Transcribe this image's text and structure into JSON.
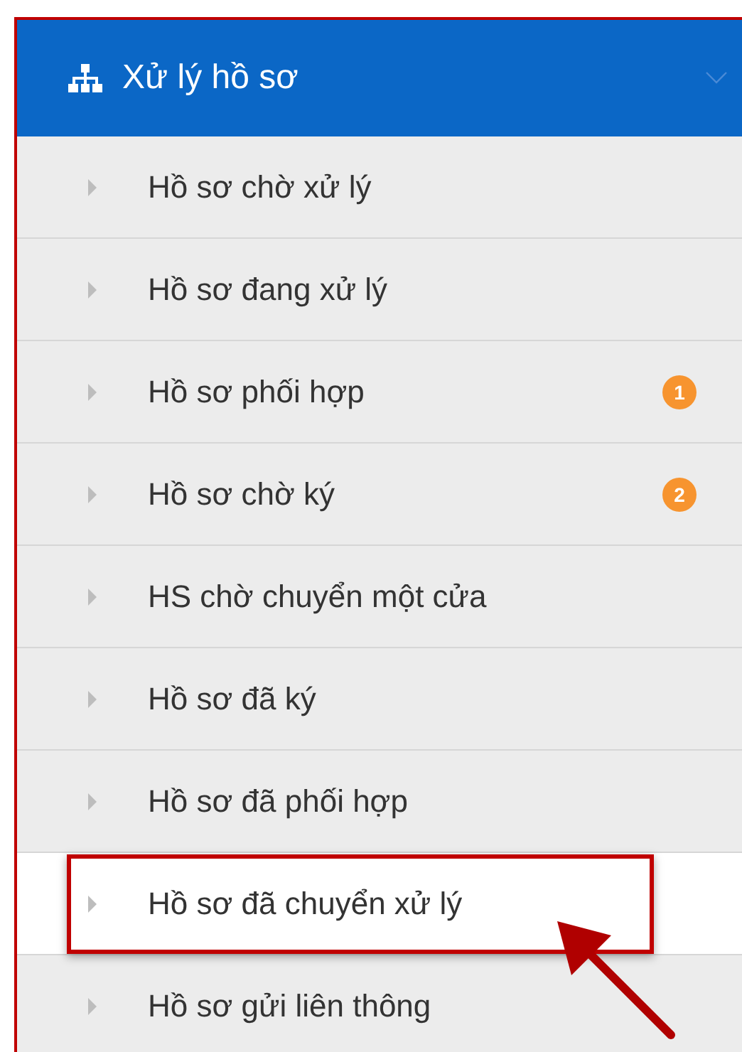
{
  "menu": {
    "title": "Xử lý hồ sơ",
    "items": [
      {
        "label": "Hồ sơ chờ xử lý",
        "selected": false
      },
      {
        "label": "Hồ sơ đang xử lý",
        "selected": false
      },
      {
        "label": "Hồ sơ phối hợp",
        "badge": "1",
        "selected": false
      },
      {
        "label": "Hồ sơ chờ ký",
        "badge": "2",
        "selected": false
      },
      {
        "label": "HS chờ chuyển một cửa",
        "selected": false
      },
      {
        "label": "Hồ sơ đã ký",
        "selected": false
      },
      {
        "label": "Hồ sơ đã phối hợp",
        "selected": false
      },
      {
        "label": "Hồ sơ đã chuyển xử lý",
        "selected": true
      },
      {
        "label": "Hồ sơ gửi liên thông",
        "selected": false
      }
    ]
  }
}
